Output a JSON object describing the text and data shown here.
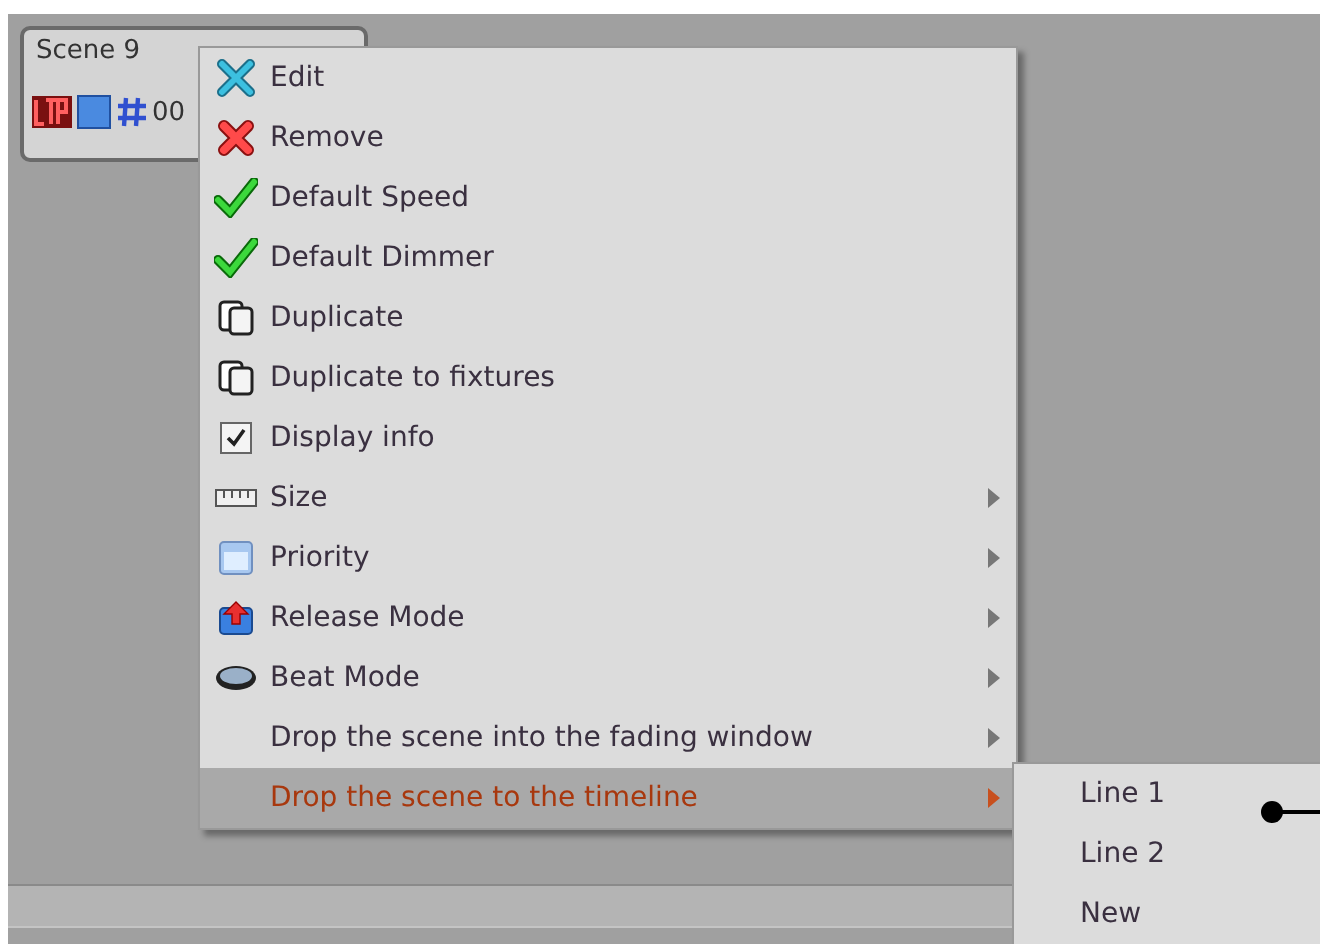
{
  "scene_card": {
    "title": "Scene 9",
    "value": "00"
  },
  "context_menu": {
    "items": [
      {
        "kind": "action",
        "label": "Edit",
        "has_submenu": false,
        "selected": false
      },
      {
        "kind": "action",
        "label": "Remove",
        "has_submenu": false,
        "selected": false
      },
      {
        "kind": "action",
        "label": "Default Speed",
        "has_submenu": false,
        "selected": false
      },
      {
        "kind": "action",
        "label": "Default Dimmer",
        "has_submenu": false,
        "selected": false
      },
      {
        "kind": "action",
        "label": "Duplicate",
        "has_submenu": false,
        "selected": false
      },
      {
        "kind": "action",
        "label": "Duplicate to fixtures",
        "has_submenu": false,
        "selected": false
      },
      {
        "kind": "checkbox",
        "label": "Display info",
        "checked": true,
        "has_submenu": false,
        "selected": false
      },
      {
        "kind": "action",
        "label": "Size",
        "has_submenu": true,
        "selected": false
      },
      {
        "kind": "action",
        "label": "Priority",
        "has_submenu": true,
        "selected": false
      },
      {
        "kind": "action",
        "label": "Release Mode",
        "has_submenu": true,
        "selected": false
      },
      {
        "kind": "action",
        "label": "Beat Mode",
        "has_submenu": true,
        "selected": false
      },
      {
        "kind": "action",
        "label": "Drop the scene into the fading window",
        "has_submenu": true,
        "selected": false
      },
      {
        "kind": "action",
        "label": "Drop the scene to the timeline",
        "has_submenu": true,
        "selected": true
      }
    ]
  },
  "submenu": {
    "items": [
      {
        "label": "Line 1",
        "selected": false
      },
      {
        "label": "Line 2",
        "selected": false
      },
      {
        "label": "New",
        "selected": false
      }
    ]
  }
}
